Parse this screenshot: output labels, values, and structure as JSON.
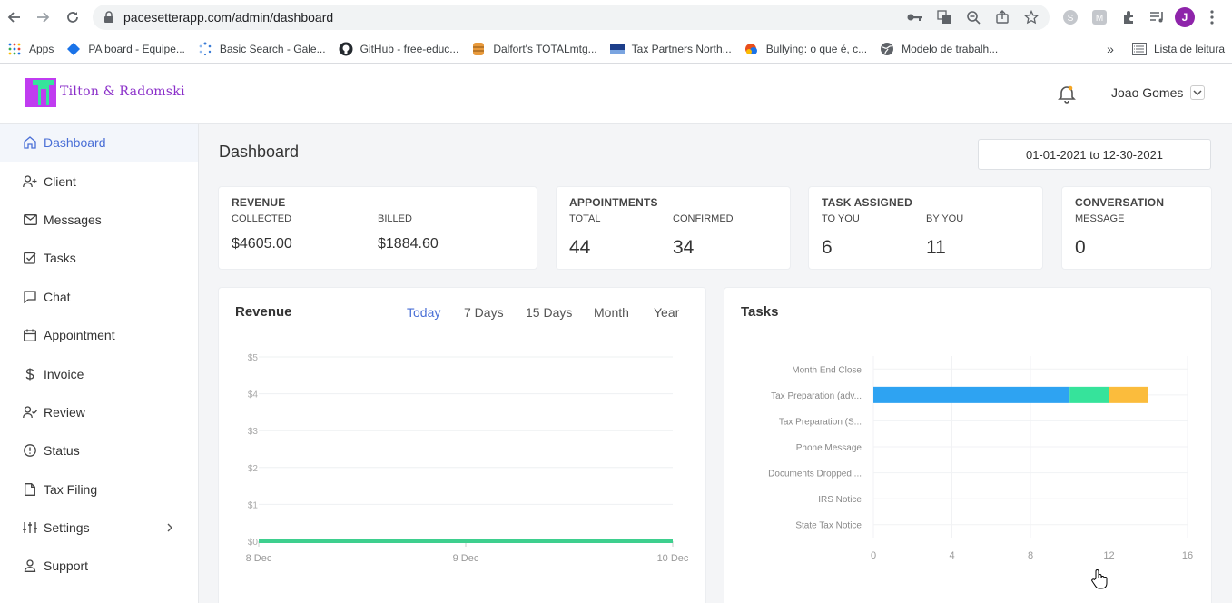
{
  "browser": {
    "url": "pacesetterapp.com/admin/dashboard",
    "profile_initial": "J",
    "bookmarks": [
      {
        "label": "Apps",
        "icon": "apps-grid-icon"
      },
      {
        "label": "PA board - Equipe...",
        "icon": "diamond-icon"
      },
      {
        "label": "Basic Search - Gale...",
        "icon": "sparkle-icon"
      },
      {
        "label": "GitHub - free-educ...",
        "icon": "github-icon"
      },
      {
        "label": "Dalfort's TOTALmtg...",
        "icon": "database-icon"
      },
      {
        "label": "Tax Partners North...",
        "icon": "flag-icon"
      },
      {
        "label": "Bullying: o que é, c...",
        "icon": "globe-colored-icon"
      },
      {
        "label": "Modelo de trabalh...",
        "icon": "globe-icon"
      }
    ],
    "more": "»",
    "reading_list": "Lista de leitura"
  },
  "header": {
    "logo_text": "Tilton & Radomski",
    "user_name": "Joao Gomes"
  },
  "sidebar": {
    "items": [
      {
        "label": "Dashboard",
        "icon": "home-icon"
      },
      {
        "label": "Client",
        "icon": "user-plus-icon"
      },
      {
        "label": "Messages",
        "icon": "mail-icon"
      },
      {
        "label": "Tasks",
        "icon": "check-square-icon"
      },
      {
        "label": "Chat",
        "icon": "chat-icon"
      },
      {
        "label": "Appointment",
        "icon": "calendar-icon"
      },
      {
        "label": "Invoice",
        "icon": "dollar-icon"
      },
      {
        "label": "Review",
        "icon": "user-check-icon"
      },
      {
        "label": "Status",
        "icon": "alert-circle-icon"
      },
      {
        "label": "Tax Filing",
        "icon": "file-icon"
      },
      {
        "label": "Settings",
        "icon": "sliders-icon"
      },
      {
        "label": "Support",
        "icon": "user-icon"
      }
    ]
  },
  "main": {
    "title": "Dashboard",
    "date_range": "01-01-2021 to 12-30-2021",
    "cards": {
      "revenue": {
        "title": "REVENUE",
        "sub1": "COLLECTED",
        "sub2": "BILLED",
        "val1": "$4605.00",
        "val2": "$1884.60"
      },
      "appointments": {
        "title": "APPOINTMENTS",
        "sub1": "TOTAL",
        "sub2": "CONFIRMED",
        "val1": "44",
        "val2": "34"
      },
      "tasks": {
        "title": "TASK ASSIGNED",
        "sub1": "TO YOU",
        "sub2": "BY YOU",
        "val1": "6",
        "val2": "11"
      },
      "conversation": {
        "title": "CONVERSATION",
        "sub1": "MESSAGE",
        "val1": "0"
      }
    },
    "revenue_panel": {
      "title": "Revenue",
      "tabs": [
        "Today",
        "7 Days",
        "15 Days",
        "Month",
        "Year"
      ],
      "active_tab": 0
    },
    "tasks_panel": {
      "title": "Tasks"
    }
  },
  "chart_data": [
    {
      "type": "line",
      "title": "Revenue",
      "x": [
        "8 Dec",
        "9 Dec",
        "10 Dec"
      ],
      "series": [
        {
          "values": [
            0,
            0,
            0
          ]
        }
      ],
      "yticks": [
        "$0",
        "$1",
        "$2",
        "$3",
        "$4",
        "$5"
      ],
      "ylim": [
        0,
        5
      ],
      "color": "#3ecf8e",
      "grid": true
    },
    {
      "type": "bar",
      "orientation": "horizontal",
      "stacked": true,
      "title": "Tasks",
      "categories": [
        "Month End Close",
        "Tax Preparation (adv...",
        "Tax Preparation (S...",
        "Phone Message",
        "Documents Dropped ...",
        "IRS Notice",
        "State Tax Notice"
      ],
      "series": [
        {
          "values": [
            0,
            10,
            0,
            0,
            0,
            0,
            0
          ],
          "color": "#2ea3f2"
        },
        {
          "values": [
            0,
            2,
            0,
            0,
            0,
            0,
            0
          ],
          "color": "#36e39b"
        },
        {
          "values": [
            0,
            2,
            0,
            0,
            0,
            0,
            0
          ],
          "color": "#fbbc3c"
        }
      ],
      "xticks": [
        0,
        4,
        8,
        12,
        16
      ],
      "xlim": [
        0,
        16
      ],
      "grid": true
    }
  ]
}
